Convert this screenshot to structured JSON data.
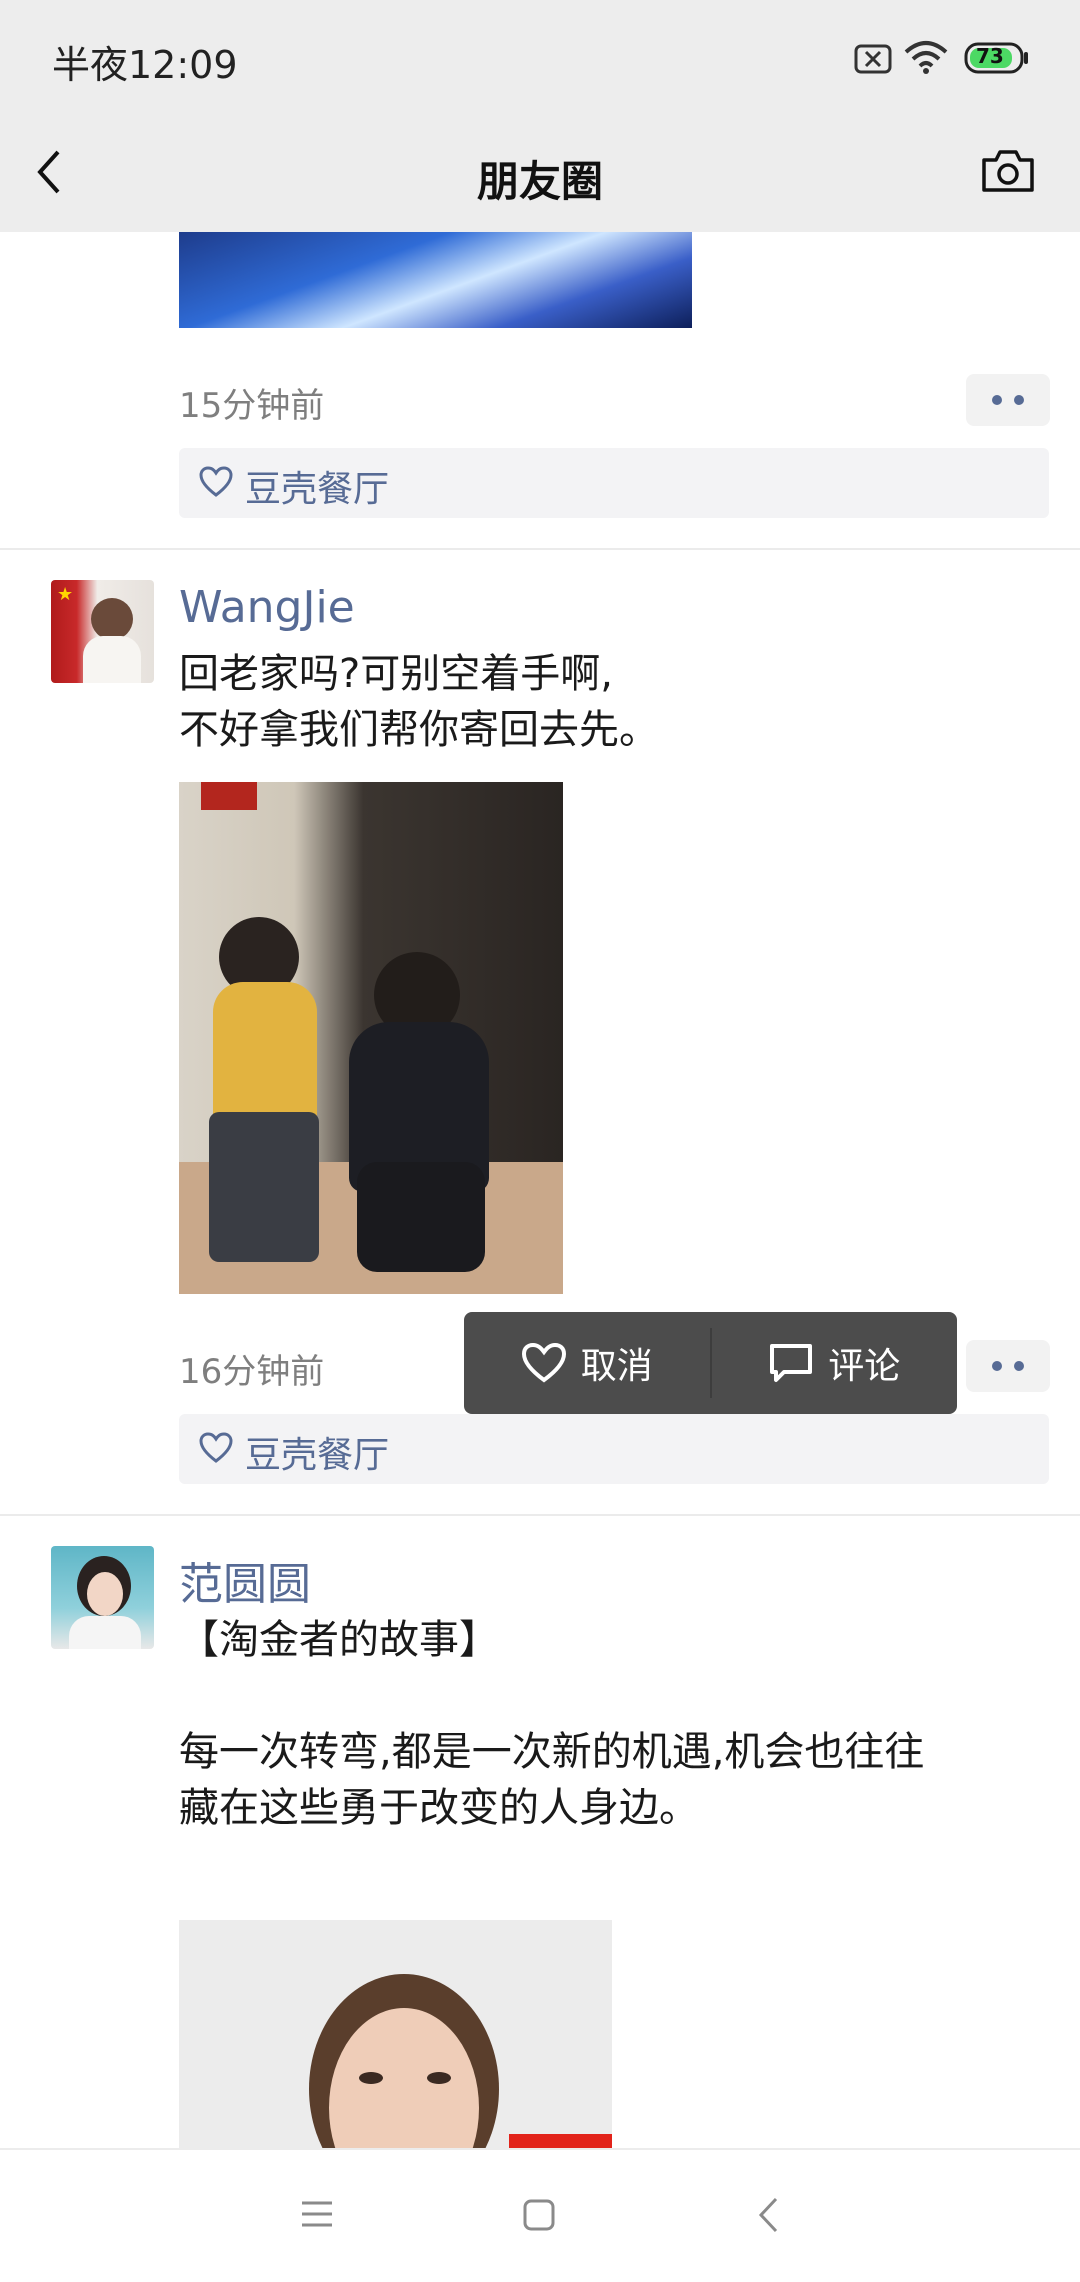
{
  "status_bar": {
    "time": "半夜12:09",
    "battery": "73"
  },
  "nav": {
    "title": "朋友圈"
  },
  "posts": [
    {
      "time": "15分钟前",
      "likes": "豆壳餐厅"
    },
    {
      "author": "WangJie",
      "text_line1": "回老家吗?可别空着手啊,",
      "text_line2": "不好拿我们帮你寄回去先。",
      "time": "16分钟前",
      "likes": "豆壳餐厅"
    },
    {
      "author": "范圆圆",
      "text_line1": "【淘金者的故事】",
      "text_line2": "每一次转弯,都是一次新的机遇,机会也往往",
      "text_line3": "藏在这些勇于改变的人身边。"
    }
  ],
  "popup": {
    "like_label": "取消",
    "comment_label": "评论"
  },
  "colors": {
    "link": "#576b95",
    "popup": "#4c4c4c",
    "battery": "#4cd964"
  }
}
